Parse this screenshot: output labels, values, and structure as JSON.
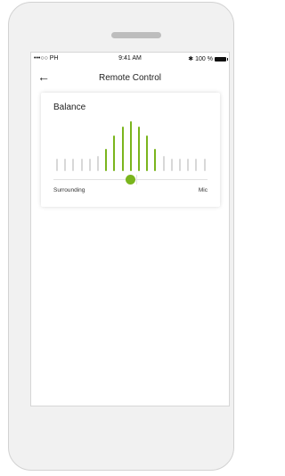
{
  "status_bar": {
    "carrier": "•••○○ PH",
    "time": "9:41 AM",
    "battery": "100 %"
  },
  "nav": {
    "back_icon": "←",
    "title": "Remote Control"
  },
  "balance": {
    "title": "Balance",
    "left_label": "Surrounding",
    "right_label": "Mic",
    "position": 0.5,
    "bar_heights": [
      0.25,
      0.25,
      0.25,
      0.25,
      0.25,
      0.3,
      0.45,
      0.72,
      0.9,
      1.0,
      0.9,
      0.72,
      0.45,
      0.3,
      0.25,
      0.25,
      0.25,
      0.25,
      0.25
    ],
    "active_color": "#7ab51d",
    "inactive_color": "#d8d8d8"
  }
}
